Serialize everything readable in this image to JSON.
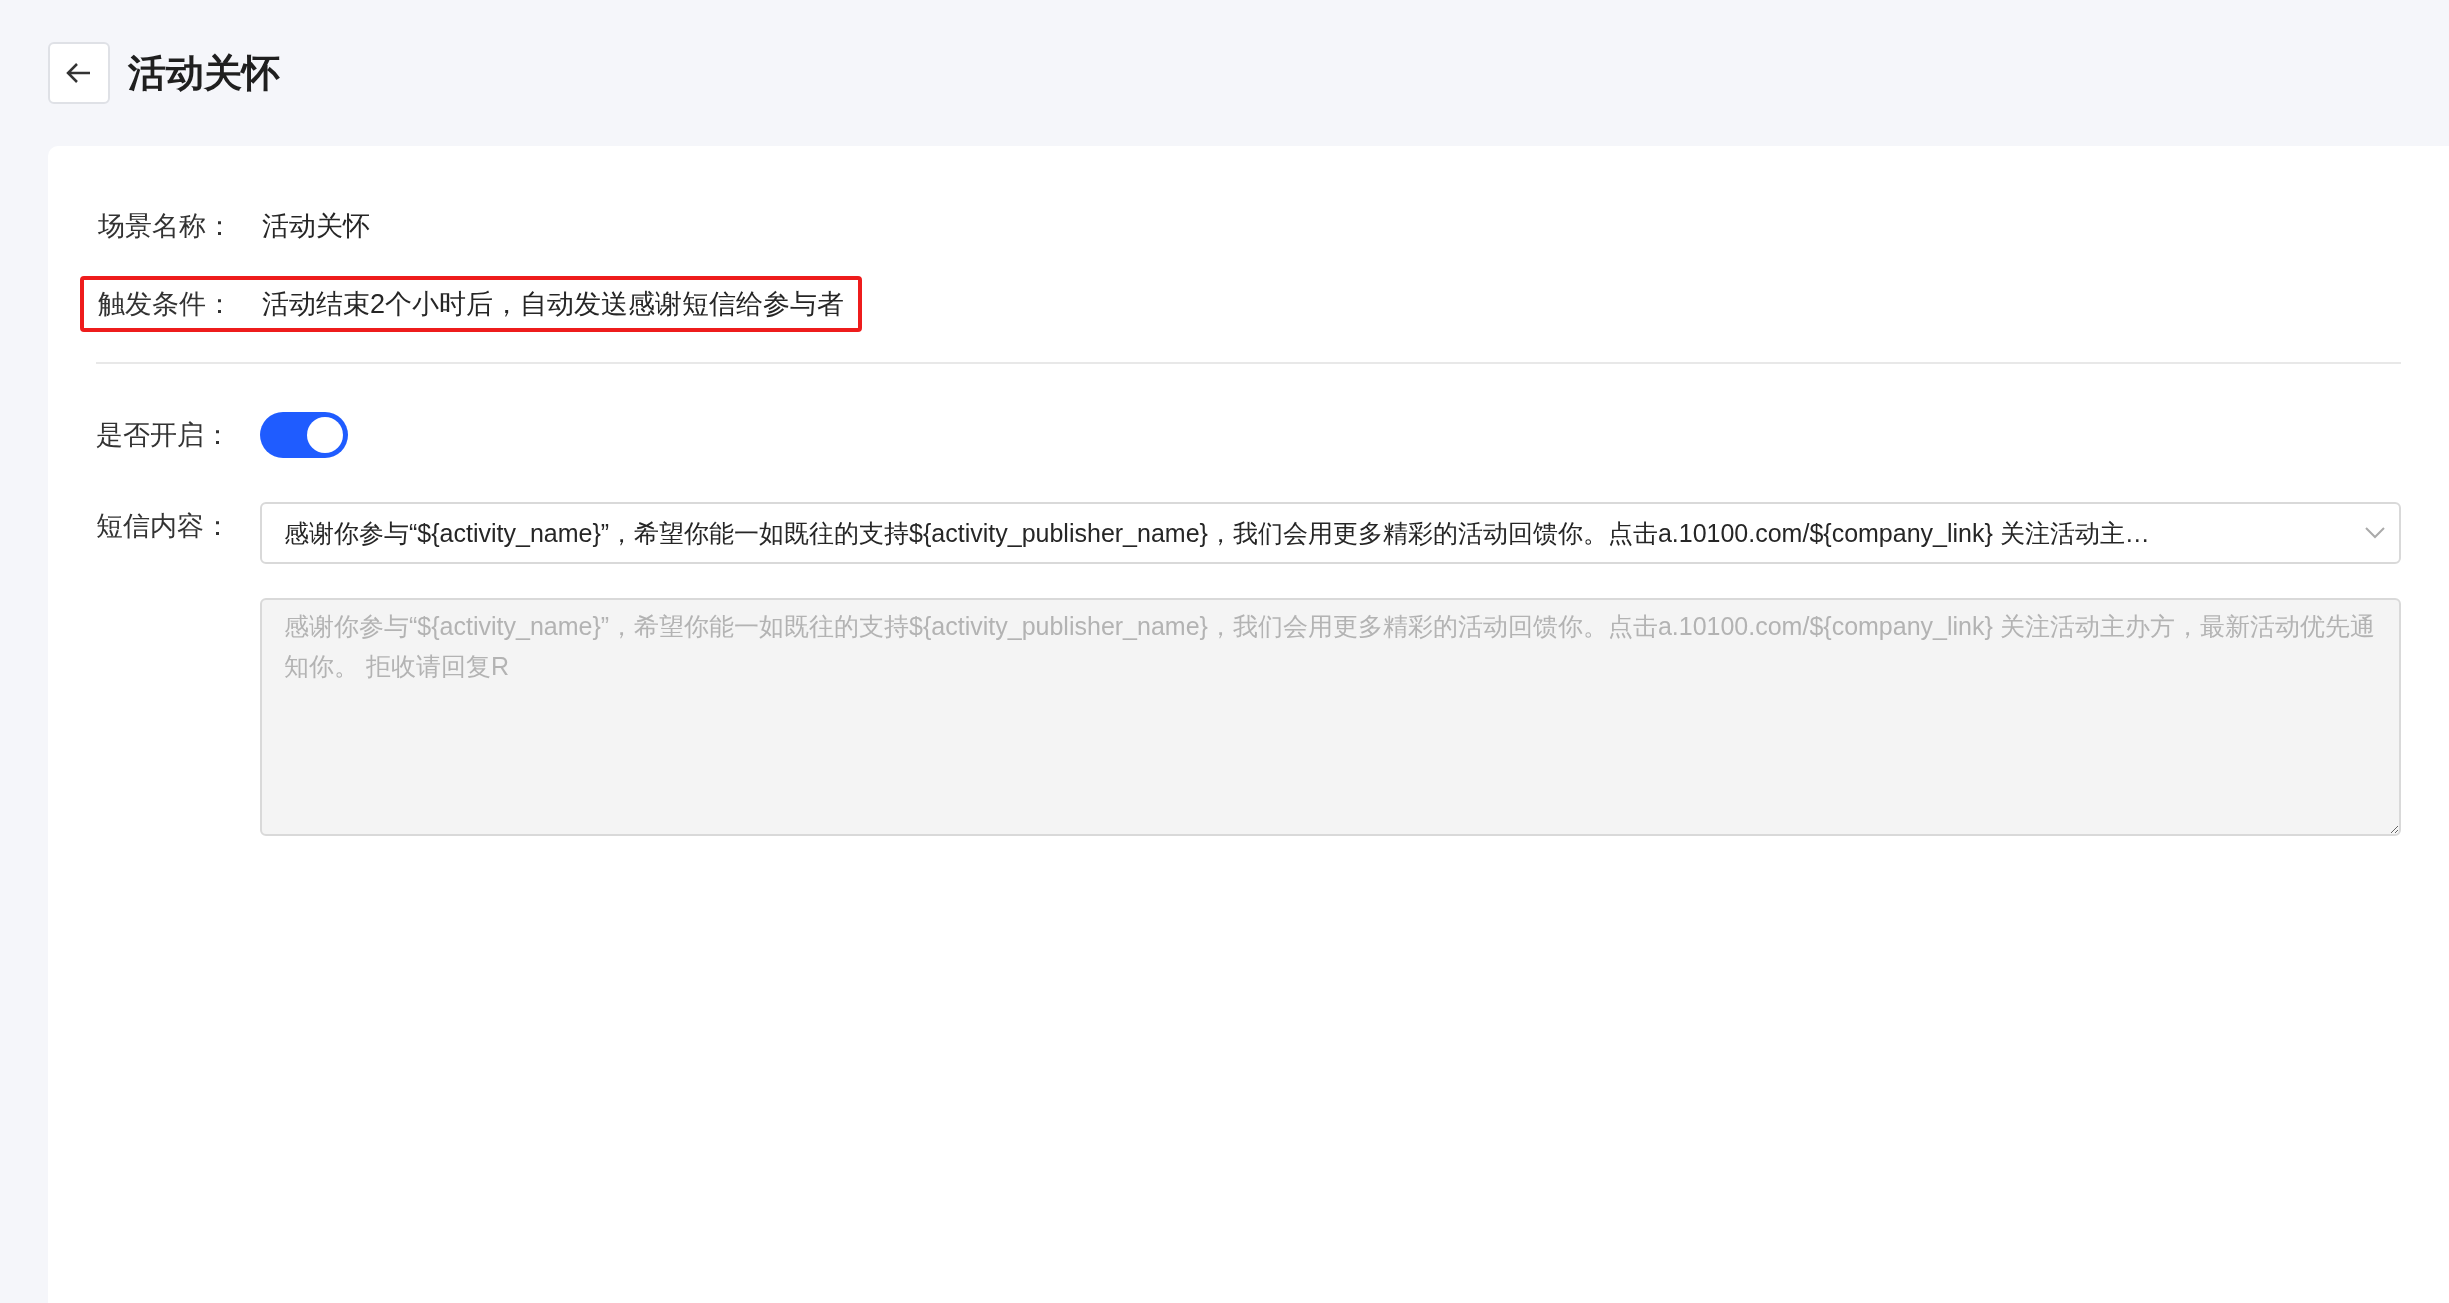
{
  "header": {
    "title": "活动关怀"
  },
  "info_rows": [
    {
      "label": "场景名称：",
      "value": "活动关怀",
      "highlighted": false
    },
    {
      "label": "触发条件：",
      "value": "活动结束2个小时后，自动发送感谢短信给参与者",
      "highlighted": true
    }
  ],
  "enable": {
    "label": "是否开启：",
    "on": true
  },
  "sms": {
    "label": "短信内容：",
    "select_value": "感谢你参与“${activity_name}”，希望你能一如既往的支持${activity_publisher_name}，我们会用更多精彩的活动回馈你。点击a.10100.com/${company_link} 关注活动主…",
    "preview": "感谢你参与“${activity_name}”，希望你能一如既往的支持${activity_publisher_name}，我们会用更多精彩的活动回馈你。点击a.10100.com/${company_link} 关注活动主办方，最新活动优先通知你。 拒收请回复R",
    "preview_disabled": true
  }
}
